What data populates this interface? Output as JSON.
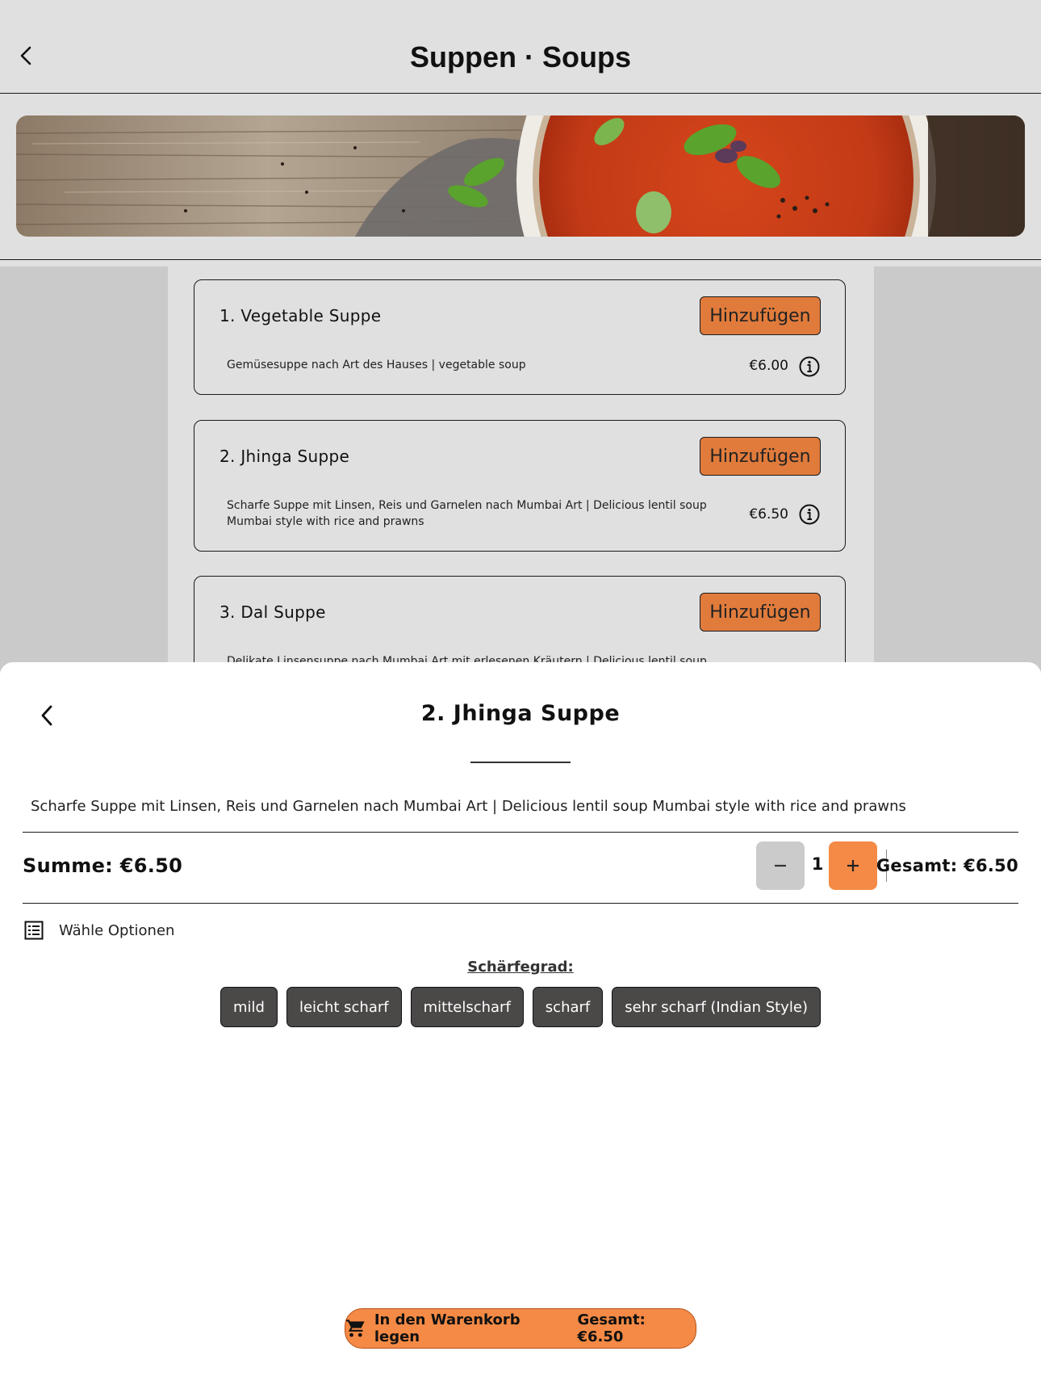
{
  "header": {
    "title": "Suppen · Soups",
    "back_icon": "chevron-left-icon"
  },
  "banner": {
    "image": "tomato-soup-banner"
  },
  "menu_items": [
    {
      "title": "1. Vegetable Suppe",
      "add_label": "Hinzufügen",
      "description": "Gemüsesuppe nach Art des Hauses | vegetable soup",
      "price": "€6.00"
    },
    {
      "title": "2. Jhinga Suppe",
      "add_label": "Hinzufügen",
      "description": "Scharfe Suppe mit Linsen, Reis und Garnelen nach Mumbai Art | Delicious lentil soup Mumbai style with rice and prawns",
      "price": "€6.50"
    },
    {
      "title": "3. Dal Suppe",
      "add_label": "Hinzufügen",
      "description": "Delikate Linsensuppe nach Mumbai Art mit erlesenen Kräutern | Delicious lentil soup"
    }
  ],
  "sheet": {
    "title": "2. Jhinga Suppe",
    "description": "Scharfe Suppe mit Linsen, Reis und Garnelen nach Mumbai Art | Delicious lentil soup Mumbai style with rice and prawns",
    "summe": "Summe: €6.50",
    "quantity": "1",
    "gesamt": "Gesamt: €6.50",
    "options_label": "Wähle Optionen",
    "spice_heading": "Schärfegrad:",
    "spice_options": [
      "mild",
      "leicht scharf",
      "mittelscharf",
      "scharf",
      "sehr scharf (Indian Style)"
    ],
    "cart_button": {
      "label": "In den Warenkorb legen",
      "total": "Gesamt: €6.50"
    }
  },
  "colors": {
    "accent_orange": "#f48a45",
    "add_button": "#e07b3c",
    "chip_bg": "#4b4848",
    "minus_bg": "#cbcbcb"
  }
}
